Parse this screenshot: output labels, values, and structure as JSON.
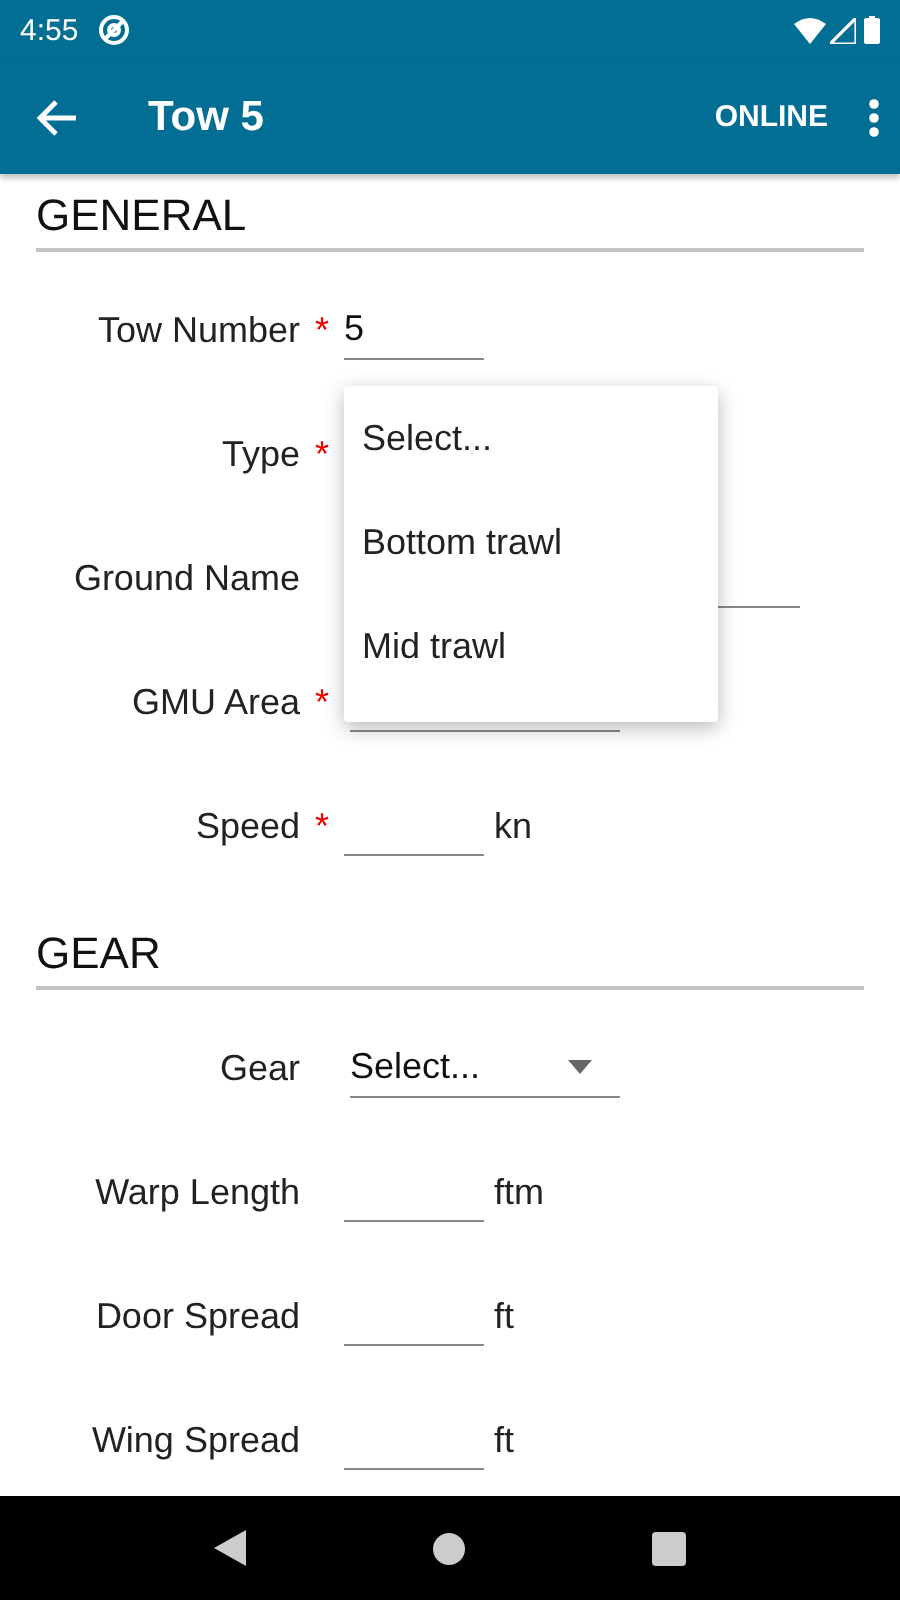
{
  "status_bar": {
    "time": "4:55"
  },
  "app_bar": {
    "title": "Tow 5",
    "action": "ONLINE"
  },
  "sections": [
    {
      "title": "GENERAL",
      "fields": [
        {
          "label": "Tow Number",
          "required_mark": "*",
          "kind": "number",
          "value": "5"
        },
        {
          "label": "Type",
          "required_mark": "*",
          "kind": "select",
          "open_menu": {
            "options": [
              "Select...",
              "Bottom trawl",
              "Mid trawl"
            ]
          }
        },
        {
          "label": "Ground Name",
          "kind": "text"
        },
        {
          "label": "GMU Area",
          "required_mark": "*",
          "kind": "select"
        },
        {
          "label": "Speed",
          "required_mark": "*",
          "kind": "number",
          "unit": "kn"
        }
      ]
    },
    {
      "title": "GEAR",
      "fields": [
        {
          "label": "Gear",
          "kind": "select",
          "value": "Select..."
        },
        {
          "label": "Warp Length",
          "kind": "number",
          "unit": "ftm"
        },
        {
          "label": "Door Spread",
          "kind": "number",
          "unit": "ft"
        },
        {
          "label": "Wing Spread",
          "kind": "number",
          "unit": "ft"
        }
      ]
    }
  ]
}
